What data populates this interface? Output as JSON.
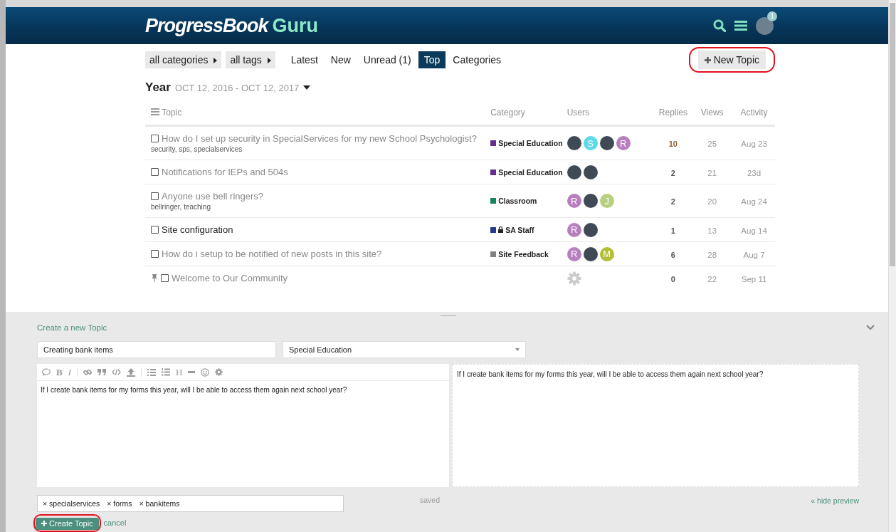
{
  "header": {
    "logo_main": "ProgressBook",
    "logo_accent": "Guru",
    "notification_count": "1"
  },
  "nav": {
    "filters": [
      "all categories",
      "all tags"
    ],
    "tabs": [
      {
        "label": "Latest",
        "selected": false
      },
      {
        "label": "New",
        "selected": false
      },
      {
        "label": "Unread (1)",
        "selected": false
      },
      {
        "label": "Top",
        "selected": true
      },
      {
        "label": "Categories",
        "selected": false
      }
    ],
    "new_topic_button": {
      "label": "New Topic",
      "highlighted": true
    }
  },
  "period": {
    "title": "Year",
    "range": "OCT 12, 2016 - OCT 12, 2017"
  },
  "table": {
    "columns": [
      "Topic",
      "Category",
      "Users",
      "Replies",
      "Views",
      "Activity"
    ],
    "rows": [
      {
        "title": "How do I set up security in SpecialServices for my new School Psychologist?",
        "visited": true,
        "checked": false,
        "tags": "security, sps, specialservices",
        "category": {
          "name": "Special Education",
          "color": "#652d90"
        },
        "users": [
          {
            "kind": "image"
          },
          {
            "kind": "letter",
            "letter": "S",
            "color": "#5ed9e8"
          },
          {
            "kind": "image"
          },
          {
            "kind": "letter",
            "letter": "R",
            "color": "#b87fbf"
          }
        ],
        "replies": "10",
        "hot": true,
        "views": "25",
        "activity": "Aug 23"
      },
      {
        "title": "Notifications for IEPs and 504s",
        "visited": true,
        "checked": false,
        "category": {
          "name": "Special Education",
          "color": "#652d90"
        },
        "users": [
          {
            "kind": "image"
          },
          {
            "kind": "image"
          }
        ],
        "replies": "2",
        "hot": false,
        "views": "21",
        "activity": "23d"
      },
      {
        "title": "Anyone use bell ringers?",
        "visited": true,
        "checked": false,
        "tags": "bellringer, teaching",
        "category": {
          "name": "Classroom",
          "color": "#12855b"
        },
        "users": [
          {
            "kind": "letter",
            "letter": "R",
            "color": "#b87fbf"
          },
          {
            "kind": "image"
          },
          {
            "kind": "letter",
            "letter": "J",
            "color": "#b8cf7f"
          }
        ],
        "replies": "2",
        "hot": false,
        "views": "20",
        "activity": "Aug 24"
      },
      {
        "title": "Site configuration",
        "visited": false,
        "checked": false,
        "category": {
          "name": "SA Staff",
          "color": "#283890",
          "locked": true
        },
        "users": [
          {
            "kind": "letter",
            "letter": "R",
            "color": "#b87fbf"
          },
          {
            "kind": "image"
          }
        ],
        "replies": "1",
        "hot": false,
        "views": "13",
        "activity": "Aug 14"
      },
      {
        "title": "How do i setup to be notified of new posts in this site?",
        "visited": true,
        "checked": false,
        "category": {
          "name": "Site Feedback",
          "color": "#808281"
        },
        "users": [
          {
            "kind": "letter",
            "letter": "R",
            "color": "#b87fbf"
          },
          {
            "kind": "image"
          },
          {
            "kind": "letter",
            "letter": "M",
            "color": "#b3bf36"
          }
        ],
        "replies": "6",
        "hot": false,
        "views": "28",
        "activity": "Aug 7"
      },
      {
        "title": "Welcome to Our Community",
        "visited": true,
        "checked": false,
        "pinned": true,
        "users": [
          {
            "kind": "system"
          }
        ],
        "replies": "0",
        "hot": false,
        "views": "22",
        "activity": "Sep 11"
      }
    ]
  },
  "composer": {
    "heading": "Create a new Topic",
    "title_value": "Creating bank items",
    "category_value": "Special Education",
    "toolbar_letters": [
      "B",
      "I",
      "H"
    ],
    "body": "If I create bank items for my forms this year, will I be able to access them again next school year?",
    "preview": "If I create bank items for my forms this year, will I be able to access them again next school year?",
    "tags": [
      "specialservices",
      "forms",
      "bankitems"
    ],
    "remove_mark": "×",
    "status": "saved",
    "hide_preview": "« hide preview",
    "create_button": {
      "label": "Create Topic",
      "highlighted": true
    },
    "cancel": "cancel"
  }
}
